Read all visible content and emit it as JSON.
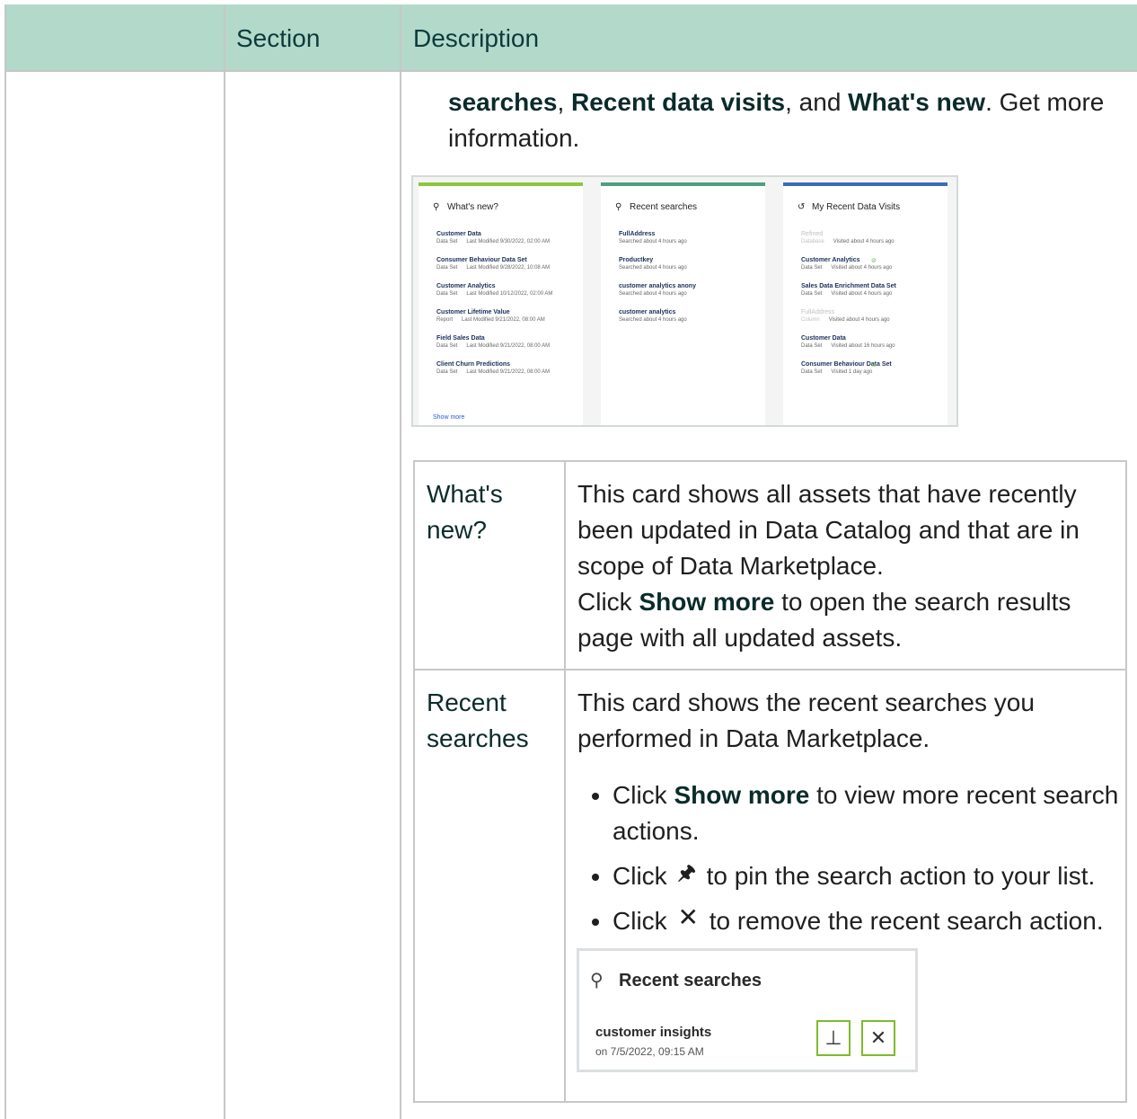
{
  "header": {
    "col_section": "Section",
    "col_description": "Description"
  },
  "intro": {
    "bold1": "searches",
    "sep1": ", ",
    "bold2": "Recent data visits",
    "sep2": ", and ",
    "bold3": "What's new",
    "rest": ". Get more information."
  },
  "screenshot": {
    "whats_new": {
      "title": "What's new?",
      "items": [
        {
          "name": "Customer Data",
          "type": "Data Set",
          "meta": "Last Modified 9/30/2022, 02:00 AM"
        },
        {
          "name": "Consumer Behaviour Data Set",
          "type": "Data Set",
          "meta": "Last Modified 9/28/2022, 10:08 AM"
        },
        {
          "name": "Customer Analytics",
          "type": "Data Set",
          "meta": "Last Modified 10/12/2022, 02:00 AM"
        },
        {
          "name": "Customer Lifetime Value",
          "type": "Report",
          "meta": "Last Modified 9/21/2022, 08:00 AM"
        },
        {
          "name": "Field Sales Data",
          "type": "Data Set",
          "meta": "Last Modified 9/21/2022, 08:00 AM"
        },
        {
          "name": "Client Churn Predictions",
          "type": "Data Set",
          "meta": "Last Modified 9/21/2022, 08:00 AM"
        }
      ],
      "show_more": "Show more"
    },
    "recent_searches": {
      "title": "Recent searches",
      "items": [
        {
          "name": "FullAddress",
          "meta": "Searched about 4 hours ago"
        },
        {
          "name": "Productkey",
          "meta": "Searched about 4 hours ago"
        },
        {
          "name": "customer analytics anony",
          "meta": "Searched about 4 hours ago"
        },
        {
          "name": "customer analytics",
          "meta": "Searched about 4 hours ago"
        }
      ]
    },
    "recent_visits": {
      "title": "My Recent Data Visits",
      "items": [
        {
          "name": "Refined",
          "type": "Database",
          "meta": "Visited about 4 hours ago",
          "faded": true
        },
        {
          "name": "Customer Analytics",
          "type": "Data Set",
          "meta": "Visited about 4 hours ago",
          "check": true
        },
        {
          "name": "Sales Data Enrichment Data Set",
          "type": "Data Set",
          "meta": "Visited about 4 hours ago"
        },
        {
          "name": "FullAddress",
          "type": "Column",
          "meta": "Visited about 4 hours ago",
          "faded": true
        },
        {
          "name": "Customer Data",
          "type": "Data Set",
          "meta": "Visited about 16 hours ago"
        },
        {
          "name": "Consumer Behaviour Data Set",
          "type": "Data Set",
          "meta": "Visited 1 day ago",
          "check": true
        }
      ]
    },
    "colors": {
      "green": "#8cc63f",
      "teal": "#4f9e7f",
      "blue": "#3b6db3"
    }
  },
  "rows": [
    {
      "label": "What's new?",
      "desc1": "This card shows all assets that have recently been updated in Data Catalog and that are in scope of Data Marketplace.",
      "desc2_pre": "Click ",
      "desc2_bold": "Show more",
      "desc2_post": " to open the search results page with all updated assets."
    },
    {
      "label": "Recent searches",
      "desc1": "This card shows the recent searches you performed in Data Marketplace.",
      "bullets": [
        {
          "pre": "Click ",
          "bold": "Show more",
          "post": " to view more recent search actions."
        },
        {
          "pre": "Click ",
          "icon": "pin-icon",
          "post": " to pin the search action to your list."
        },
        {
          "pre": "Click ",
          "icon": "close-icon",
          "post": " to remove the recent search action."
        }
      ]
    }
  ],
  "recent_searches_example": {
    "title": "Recent searches",
    "query": "customer insights",
    "date": "on 7/5/2022, 09:15 AM"
  }
}
